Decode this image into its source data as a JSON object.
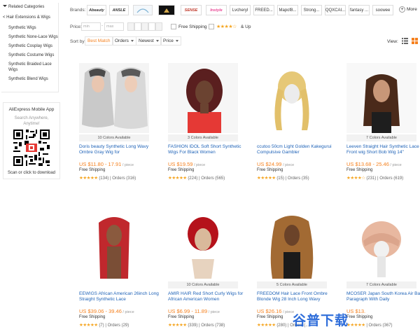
{
  "sidebar": {
    "related_heading": "Related Categories",
    "parent_category": "< Hair Extensions & Wigs",
    "categories": [
      "Synthetic Wigs",
      "Synthetic None-Lace Wigs",
      "Synthetic Cosplay Wigs",
      "Synthetic Costume Wigs",
      "Synthetic Braided Lace Wigs",
      "Synthetic Blend Wigs"
    ],
    "app": {
      "title": "AliExpress Mobile App",
      "subtitle_line1": "Search Anywhere,",
      "subtitle_line2": "Anytime!",
      "footer": "Scan or click to download"
    }
  },
  "filters": {
    "brands_label": "Brands:",
    "brands": [
      "Abeauty",
      "ANSLE",
      "",
      "",
      "SENSE",
      "Instyle",
      "Lvcheryl",
      "FREED...",
      "Mapof8...",
      "Strong...",
      "QQXCAI...",
      "fantasy ...",
      "soowee"
    ],
    "more_label": "More",
    "price_label": "Price:",
    "price_min_placeholder": "min",
    "price_max_placeholder": "max",
    "free_shipping_label": "Free Shipping",
    "rating_stars": "★★★★☆",
    "rating_suffix": "& Up",
    "sort_label": "Sort by:",
    "sort_options": [
      "Best Match",
      "Orders",
      "Newest",
      "Price"
    ],
    "view_label": "View:"
  },
  "products": [
    {
      "colors": "10 Colors Available",
      "title": "Doris beauty Synthetic Long Wavy Ombre Gray Wig for",
      "price": "US $11.80 - 17.91",
      "unit": " / piece",
      "shipping": "Free Shipping",
      "stars": "★★★★★",
      "reviews": "(134)",
      "orders": "Orders (316)"
    },
    {
      "colors": "3 Colors Available",
      "title": "FASHION IDOL Soft Short Synthetic Wigs For Black Women",
      "price": "US $19.59",
      "unit": " / piece",
      "shipping": "Free Shipping",
      "stars": "★★★★★",
      "reviews": "(224)",
      "orders": "Orders (565)"
    },
    {
      "colors": "",
      "title": "ccutoo 50cm Light Golden Kakegurui Compulsive Gambler",
      "price": "US $24.99",
      "unit": " / piece",
      "shipping": "Free Shipping",
      "stars": "★★★★★",
      "reviews": "(15)",
      "orders": "Orders (35)"
    },
    {
      "colors": "7 Colors Available",
      "title": "Leeven Straight Hair Synthetic Lace Front wig Short Bob Wig 14\"",
      "price": "US $13.68 - 25.46",
      "unit": " / piece",
      "shipping": "Free Shipping",
      "stars": "★★★★☆",
      "reviews": "(231)",
      "orders": "Orders (619)"
    },
    {
      "colors": "",
      "title": "EEWIGS African American 26inch Long Straight Synthetic Lace",
      "price": "US $39.06 - 39.46",
      "unit": " / piece",
      "shipping": "Free Shipping",
      "stars": "★★★★★",
      "reviews": "(7)",
      "orders": "Orders (29)"
    },
    {
      "colors": "10 Colors Available",
      "title": "AMIR HAIR Red Short Curly Wigs for African American Women",
      "price": "US $6.99 - 11.89",
      "unit": " / piece",
      "shipping": "Free Shipping",
      "stars": "★★★★★",
      "reviews": "(339)",
      "orders": "Orders (738)"
    },
    {
      "colors": "5 Colors Available",
      "title": "FREEDOM Hair Lace Front Ombre Blonde Wig 28 Inch Long Wavy",
      "price": "US $26.16",
      "unit": " / piece",
      "shipping": "Free Shipping",
      "stars": "★★★★★",
      "reviews": "(280)",
      "orders": "Orders (..."
    },
    {
      "colors": "7 Colors Available",
      "title": "MCOSER Japan South Korea Air Bang Paragraph With Daily",
      "price": "US $13.",
      "unit": "",
      "shipping": "Free Shipping",
      "stars": "★★★★★",
      "reviews": "",
      "orders": "Orders (367)"
    }
  ],
  "watermark": "谷普下载"
}
